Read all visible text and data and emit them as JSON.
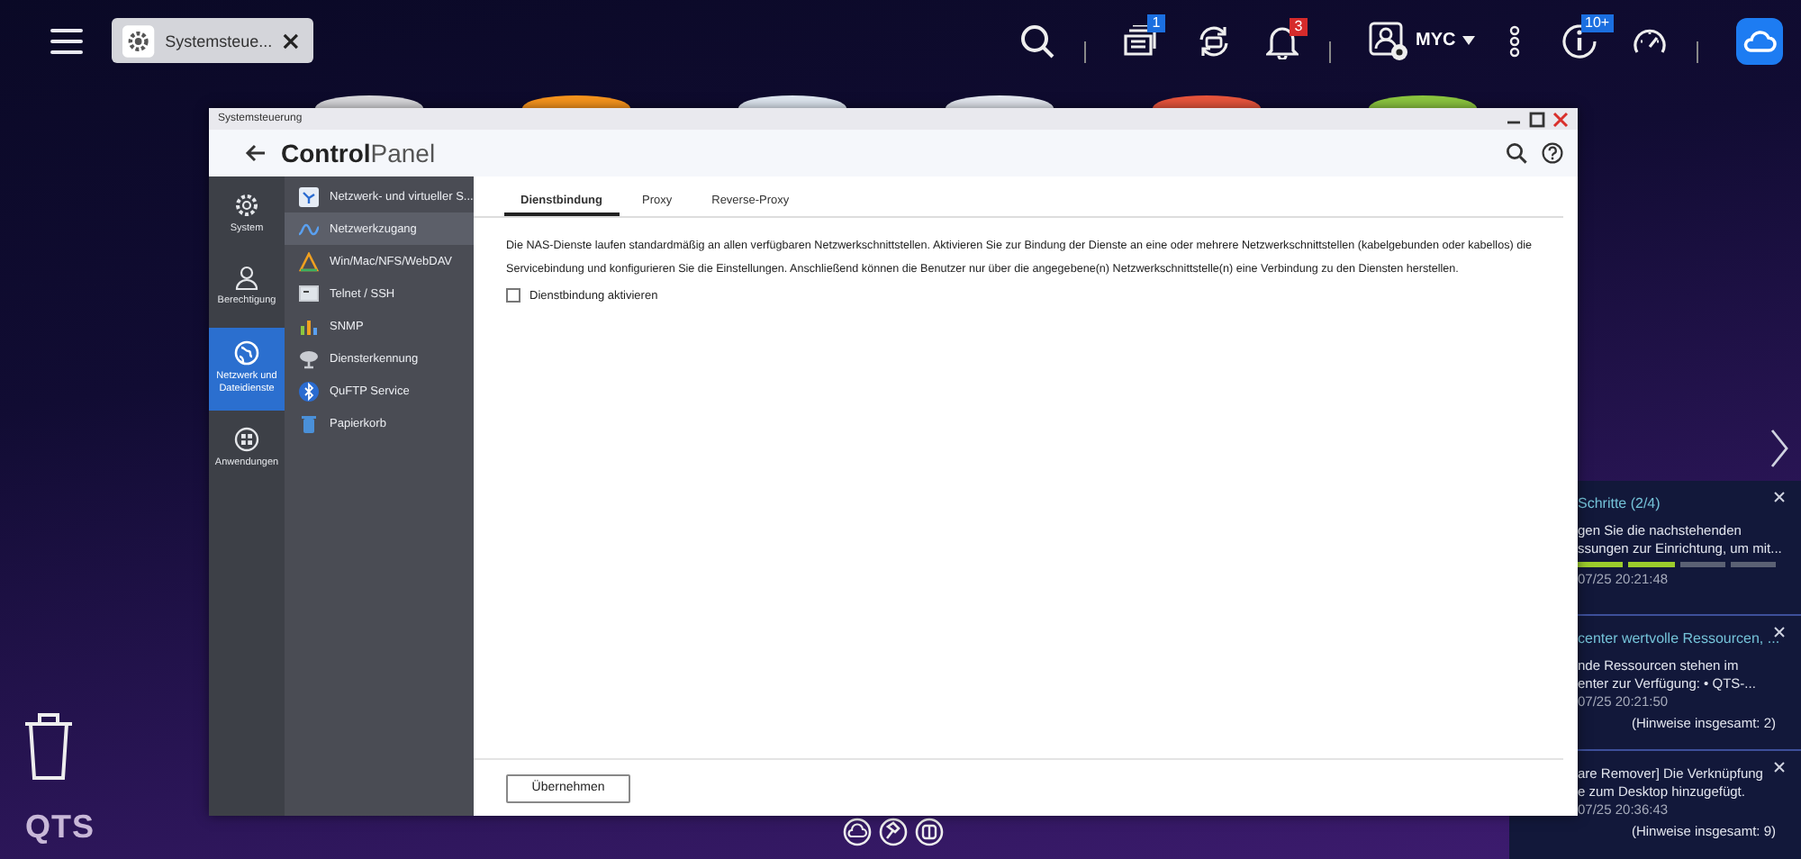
{
  "topbar": {
    "tab": {
      "label": "Systemsteue..."
    },
    "badges": {
      "tasks": "1",
      "alerts": "3",
      "updates": "10+"
    },
    "user": "MYC"
  },
  "desktop": {
    "app_icons": [
      {
        "color": "#d9d9dc"
      },
      {
        "color": "#f7941d"
      },
      {
        "color": "#dfe7f1"
      },
      {
        "color": "#e4e8f0"
      },
      {
        "color": "#e8553c"
      },
      {
        "color": "#8cc63f"
      }
    ],
    "trash_label": "QTS"
  },
  "window": {
    "title": "Systemsteuerung",
    "heading_bold": "Control",
    "heading_light": "Panel",
    "categories": [
      {
        "label": "System",
        "selected": false
      },
      {
        "label": "Berechtigung",
        "selected": false
      },
      {
        "label": "Netzwerk und Dateidienste",
        "selected": true
      },
      {
        "label": "Anwendungen",
        "selected": false
      }
    ],
    "menu": [
      {
        "label": "Netzwerk- und virtueller S...",
        "selected": false
      },
      {
        "label": "Netzwerkzugang",
        "selected": true
      },
      {
        "label": "Win/Mac/NFS/WebDAV",
        "selected": false
      },
      {
        "label": "Telnet / SSH",
        "selected": false
      },
      {
        "label": "SNMP",
        "selected": false
      },
      {
        "label": "Diensterkennung",
        "selected": false
      },
      {
        "label": "QuFTP Service",
        "selected": false
      },
      {
        "label": "Papierkorb",
        "selected": false
      }
    ],
    "tabs": [
      {
        "label": "Dienstbindung",
        "selected": true
      },
      {
        "label": "Proxy",
        "selected": false
      },
      {
        "label": "Reverse-Proxy",
        "selected": false
      }
    ],
    "description": "Die NAS-Dienste laufen standardmäßig an allen verfügbaren Netzwerkschnittstellen. Aktivieren Sie zur Bindung der Dienste an eine oder mehrere Netzwerkschnittstellen (kabelgebunden oder kabellos) die Servicebindung und konfigurieren Sie die Einstellungen. Anschließend können die Benutzer nur über die angegebene(n) Netzwerkschnittstelle(n) eine Verbindung zu den Diensten herstellen.",
    "checkbox": {
      "label": "Dienstbindung aktivieren",
      "checked": false
    },
    "apply_button": "Übernehmen"
  },
  "notifications": [
    {
      "title": "Schritte (2/4)",
      "lines": [
        "gen Sie die nachstehenden",
        "ssungen zur Einrichtung, um mit..."
      ],
      "steps": [
        {
          "done": true
        },
        {
          "done": true
        },
        {
          "done": false
        },
        {
          "done": false
        }
      ],
      "time": "07/25 20:21:48"
    },
    {
      "title": "center wertvolle Ressourcen, ...",
      "lines": [
        "nde Ressourcen stehen im",
        "enter zur Verfügung: • QTS-..."
      ],
      "time": "07/25 20:21:50",
      "total": "(Hinweise insgesamt: 2)"
    },
    {
      "lines": [
        "are Remover] Die Verknüpfung",
        "e zum Desktop hinzugefügt."
      ],
      "time": "07/25 20:36:43",
      "total": "(Hinweise insgesamt: 9)"
    }
  ]
}
